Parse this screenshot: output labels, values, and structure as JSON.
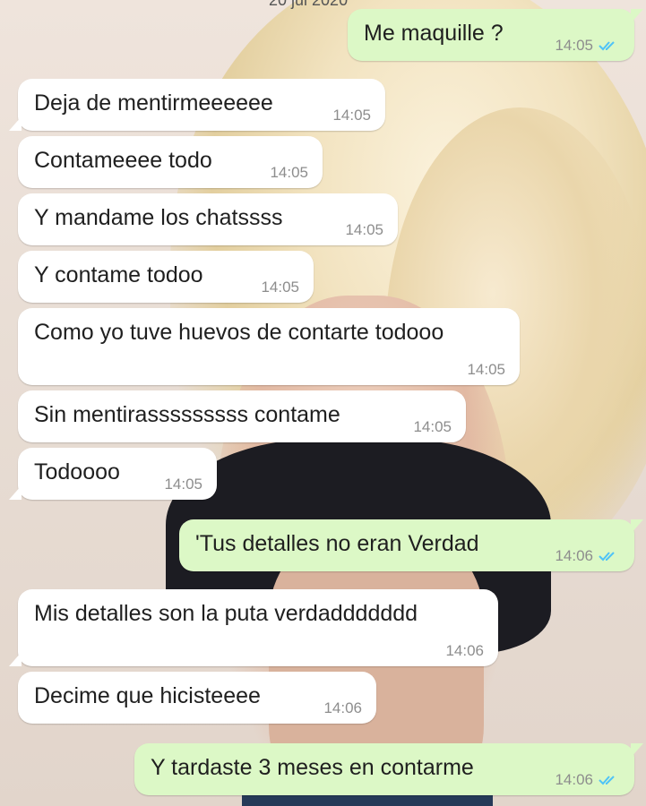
{
  "header_fragment": "20 jul 2020",
  "tick_color": "#4fc3f7",
  "messages": [
    {
      "dir": "out",
      "text": "Me maquille ?",
      "time": "14:05",
      "status": "read"
    },
    {
      "dir": "in",
      "text": "Deja de mentirmeeeeee",
      "time": "14:05"
    },
    {
      "dir": "in",
      "text": "Contameeee todo",
      "time": "14:05"
    },
    {
      "dir": "in",
      "text": "Y mandame los chatssss",
      "time": "14:05"
    },
    {
      "dir": "in",
      "text": "Y contame todoo",
      "time": "14:05"
    },
    {
      "dir": "in",
      "text": "Como yo tuve huevos de contarte todooo",
      "time": "14:05"
    },
    {
      "dir": "in",
      "text": "Sin mentirasssssssss contame",
      "time": "14:05"
    },
    {
      "dir": "in",
      "text": "Todoooo",
      "time": "14:05"
    },
    {
      "dir": "out",
      "text": "'Tus detalles no eran Verdad",
      "time": "14:06",
      "status": "read"
    },
    {
      "dir": "in",
      "text": "Mis detalles son la puta verdaddddddd",
      "time": "14:06"
    },
    {
      "dir": "in",
      "text": "Decime que hicisteeee",
      "time": "14:06"
    },
    {
      "dir": "out",
      "text": "Y tardaste 3 meses en contarme",
      "time": "14:06",
      "status": "read"
    }
  ]
}
